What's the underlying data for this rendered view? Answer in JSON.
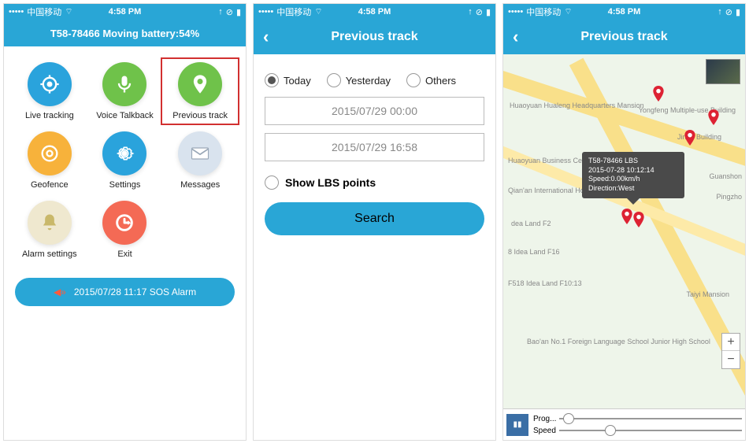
{
  "status": {
    "carrier": "中国移动",
    "time": "4:58 PM",
    "signal": "•••••",
    "wifi": "wifi",
    "right": "⇧ ⦿ ▮"
  },
  "screen1": {
    "title": "T58-78466 Moving battery:54%",
    "items": [
      {
        "label": "Live tracking",
        "bg": "#2aa3dc",
        "icon": "target"
      },
      {
        "label": "Voice Talkback",
        "bg": "#6fc24a",
        "icon": "mic"
      },
      {
        "label": "Previous track",
        "bg": "#6fc24a",
        "icon": "pin",
        "highlight": true
      },
      {
        "label": "Geofence",
        "bg": "#f7b23b",
        "icon": "fence"
      },
      {
        "label": "Settings",
        "bg": "#2aa3dc",
        "icon": "gear"
      },
      {
        "label": "Messages",
        "bg": "#d9e3ee",
        "icon": "mail"
      },
      {
        "label": "Alarm settings",
        "bg": "#efe8cf",
        "icon": "bell"
      },
      {
        "label": "Exit",
        "bg": "#f46a55",
        "icon": "exit"
      }
    ],
    "sos": "2015/07/28 11:17 SOS Alarm"
  },
  "screen2": {
    "title": "Previous track",
    "radios": {
      "today": "Today",
      "yesterday": "Yesterday",
      "others": "Others"
    },
    "date_from": "2015/07/29 00:00",
    "date_to": "2015/07/29 16:58",
    "show_lbs": "Show LBS points",
    "search": "Search"
  },
  "screen3": {
    "title": "Previous track",
    "tooltip": {
      "line1": "T58-78466  LBS",
      "line2": "2015-07-28 10:12:14",
      "line3": "Speed:0.00km/h Direction:West"
    },
    "map_labels": [
      "Huaoyuan Hualeng Headquarters Mansion",
      "Yongfeng Multiple-use Building",
      "Jingu Building",
      "Huaoyuan Business Center",
      "Qian'an International Hotel",
      "Guanshon",
      "Pingzho",
      "dea Land F2",
      "8 Idea Land F16",
      "F518 Idea Land F10:13",
      "Taiyi Mansion",
      "Bao'an No.1 Foreign Language School Junior High School"
    ],
    "play": {
      "prog": "Prog...",
      "speed": "Speed"
    }
  }
}
